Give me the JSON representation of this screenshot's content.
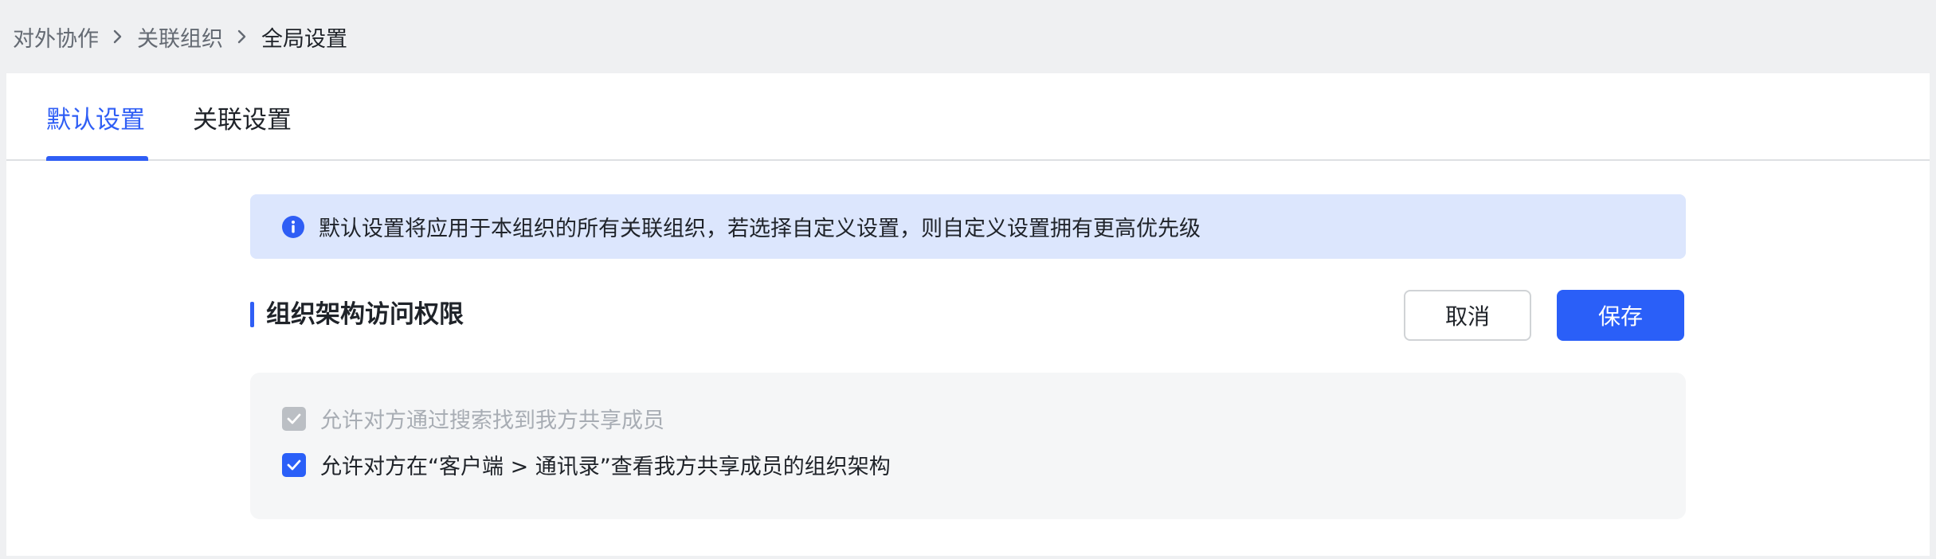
{
  "breadcrumb": {
    "items": [
      "对外协作",
      "关联组织",
      "全局设置"
    ]
  },
  "tabs": [
    {
      "label": "默认设置",
      "active": true
    },
    {
      "label": "关联设置",
      "active": false
    }
  ],
  "banner": {
    "text": "默认设置将应用于本组织的所有关联组织，若选择自定义设置，则自定义设置拥有更高优先级",
    "icon": "info-icon"
  },
  "section": {
    "title": "组织架构访问权限",
    "cancel_label": "取消",
    "save_label": "保存"
  },
  "options": [
    {
      "label": "允许对方通过搜索找到我方共享成员",
      "checked": true,
      "disabled": true
    },
    {
      "label": "允许对方在“客户端 > 通讯录”查看我方共享成员的组织架构",
      "checked": true,
      "disabled": false
    }
  ],
  "colors": {
    "accent": "#2f5ef5",
    "banner_bg": "#dce6fd",
    "page_bg": "#eff0f2",
    "disabled_check": "#bbbfc4"
  }
}
